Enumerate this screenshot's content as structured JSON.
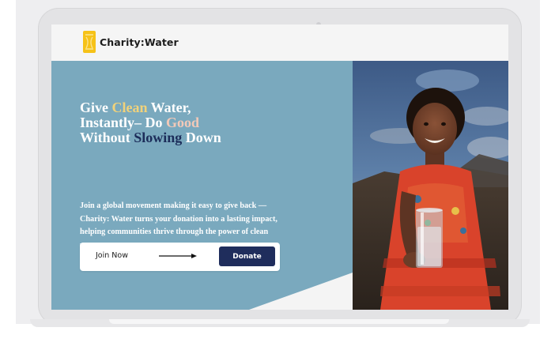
{
  "brand": {
    "name": "Charity:Water",
    "logo_icon": "jerrycan-logo-icon",
    "logo_color": "#f6c218"
  },
  "hero": {
    "headline": {
      "line1": {
        "before": "Give ",
        "highlight": "Clean",
        "after": " Water,"
      },
      "line2": {
        "before": "Instantly– Do ",
        "highlight": "Good",
        "after": ""
      },
      "line3": {
        "before": "Without ",
        "highlight": "Slowing",
        "after": " Down"
      }
    },
    "subcopy": "Join a global movement making it easy to give back — Charity: Water turns your donation into a lasting impact, helping communities thrive through the power of clean water.",
    "background_color": "#7aa9be",
    "highlight_colors": {
      "clean": "#f1d27a",
      "good": "#f3c9b8",
      "slowing": "#1c2d5a"
    }
  },
  "cta": {
    "join_label": "Join Now",
    "arrow_icon": "arrow-right-icon",
    "donate_label": "Donate",
    "donate_color": "#1f2d5c"
  },
  "photo": {
    "icon": "hero-photo-girl-with-water-glass"
  }
}
